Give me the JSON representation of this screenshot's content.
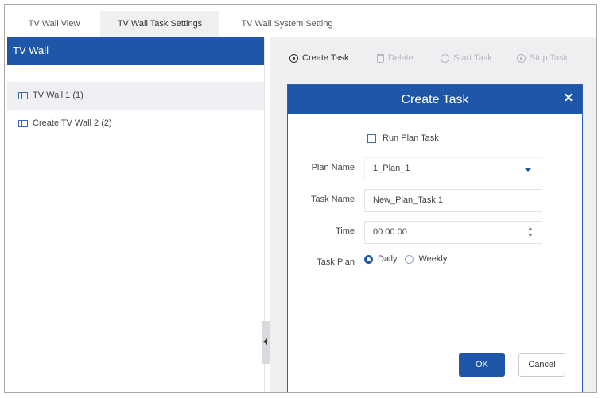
{
  "tabs": [
    {
      "label": "TV Wall View",
      "active": false
    },
    {
      "label": "TV Wall Task Settings",
      "active": true
    },
    {
      "label": "TV Wall System Setting",
      "active": false
    }
  ],
  "left_panel": {
    "title": "TV Wall",
    "items": [
      {
        "label": "TV Wall 1 (1)",
        "selected": true
      },
      {
        "label": "Create TV Wall 2 (2)",
        "selected": false
      }
    ]
  },
  "toolbar": {
    "create_label": "Create Task",
    "delete_label": "Delete",
    "start_label": "Start Task",
    "stop_label": "Stop Task"
  },
  "dialog": {
    "title": "Create Task",
    "close_glyph": "✕",
    "run_plan_task_label": "Run Plan Task",
    "plan_name_label": "Plan Name",
    "plan_name_value": "1_Plan_1",
    "task_name_label": "Task Name",
    "task_name_value": "New_Plan_Task 1",
    "time_label": "Time",
    "time_value": "00:00:00",
    "task_plan_label": "Task Plan",
    "task_plan_options": [
      "Daily",
      "Weekly"
    ],
    "task_plan_selected": "Daily",
    "ok_label": "OK",
    "cancel_label": "Cancel"
  },
  "colors": {
    "accent": "#1f57a8",
    "panel_bg": "#eeeff1",
    "disabled_text": "#b6b8bc"
  },
  "icons": {
    "wall_item": "tv-wall-icon",
    "create": "plus-circle-icon",
    "delete": "trash-icon",
    "start": "start-icon",
    "stop": "stop-icon",
    "collapse": "chevron-left-icon"
  }
}
